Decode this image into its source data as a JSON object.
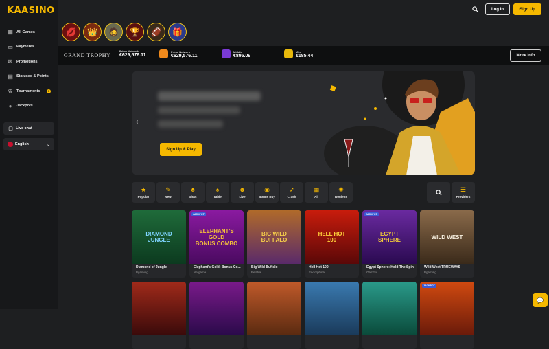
{
  "brand": {
    "logo": "KAASINO",
    "accent": "#f5b800"
  },
  "sidebar": {
    "items": [
      {
        "label": "All Games",
        "icon": "grid-icon"
      },
      {
        "label": "Payments",
        "icon": "wallet-icon"
      },
      {
        "label": "Promotions",
        "icon": "gift-icon"
      },
      {
        "label": "Statuses & Points",
        "icon": "ticket-icon"
      },
      {
        "label": "Tournaments",
        "icon": "trophy-icon",
        "badge": "1"
      },
      {
        "label": "Jackpots",
        "icon": "moneybag-icon"
      }
    ],
    "live_chat": "Live chat",
    "language": "English"
  },
  "header": {
    "login": "Log In",
    "signup": "Sign Up"
  },
  "jackpot": {
    "brand": "GRAND TROPHY",
    "items": [
      {
        "label": "Prime Network",
        "amount": "€629,576.11"
      },
      {
        "label": "Prime Network",
        "amount": "€629,576.11"
      },
      {
        "label": "Middle",
        "amount": "€895.09"
      },
      {
        "label": "Mini",
        "amount": "€185.44"
      }
    ],
    "more": "More Info"
  },
  "banner": {
    "cta": "Sign Up & Play"
  },
  "categories": [
    {
      "label": "Popular",
      "icon": "star-icon"
    },
    {
      "label": "New",
      "icon": "broom-icon"
    },
    {
      "label": "Slots",
      "icon": "clover-icon"
    },
    {
      "label": "Table",
      "icon": "spade-icon"
    },
    {
      "label": "Live",
      "icon": "dealer-icon"
    },
    {
      "label": "Bonus Buy",
      "icon": "coins-icon"
    },
    {
      "label": "Crash",
      "icon": "rocket-icon"
    },
    {
      "label": "All",
      "icon": "grid-icon"
    },
    {
      "label": "Roulette",
      "icon": "roulette-icon"
    }
  ],
  "providers": "Providers",
  "games": [
    {
      "name": "Diamond of Jungle",
      "provider": "Bgaming",
      "art": "DIAMOND\nJUNGLE",
      "jackpot": false
    },
    {
      "name": "Elephant's Gold: Bonus Co...",
      "provider": "Netgame",
      "art": "ELEPHANT'S\nGOLD\nBONUS COMBO",
      "jackpot": true
    },
    {
      "name": "Big Wild Buffalo",
      "provider": "Belatra",
      "art": "BIG WILD\nBUFFALO",
      "jackpot": false
    },
    {
      "name": "Hell Hot 100",
      "provider": "Endorphina",
      "art": "HELL HOT\n100",
      "jackpot": false
    },
    {
      "name": "Egypt Sphere: Hold The Spin",
      "provider": "Gamzix",
      "art": "EGYPT\nSPHERE",
      "jackpot": true
    },
    {
      "name": "Wild West TRUEWAYS",
      "provider": "Bgaming",
      "art": "WILD WEST",
      "jackpot": false
    }
  ],
  "jackpot_tag": "JACKPOT"
}
